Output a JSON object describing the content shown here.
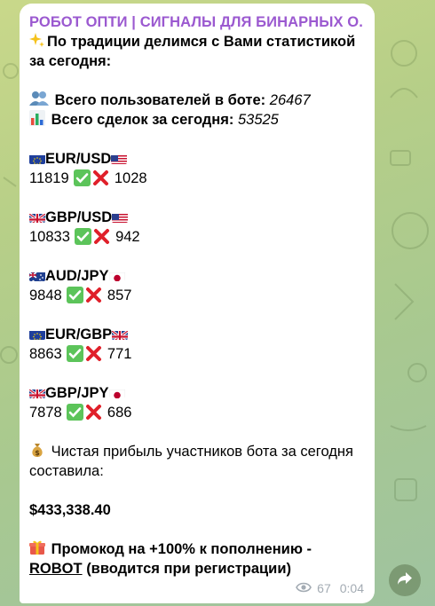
{
  "message": {
    "sender": "РОБОТ ОПТИ | СИГНАЛЫ ДЛЯ БИНАРНЫХ О...",
    "intro_line1": "По традиции делимся с Вами статистикой",
    "intro_line2": "за сегодня:",
    "users_label": "Всего пользователей в боте:",
    "users_value": "26467",
    "deals_label": "Всего сделок за сегодня:",
    "deals_value": "53525",
    "pairs": [
      {
        "name": "EUR/USD",
        "wins": "11819",
        "losses": "1028"
      },
      {
        "name": "GBP/USD",
        "wins": "10833",
        "losses": "942"
      },
      {
        "name": "AUD/JPY",
        "wins": "9848",
        "losses": "857"
      },
      {
        "name": "EUR/GBP",
        "wins": "8863",
        "losses": "771"
      },
      {
        "name": "GBP/JPY",
        "wins": "7878",
        "losses": "686"
      }
    ],
    "profit_line1": "Чистая прибыль участников бота за сегодня",
    "profit_line2": "составила:",
    "profit_value": "$433,338.40",
    "promo_line1": "Промокод на +100% к пополнению -",
    "promo_code": "ROBOT",
    "promo_rest": "(вводится при регистрации)",
    "views": "67",
    "time": "0:04"
  },
  "icons": {
    "sparkles": "sparkles-icon",
    "users": "busts-icon",
    "chart": "bar-chart-icon",
    "win": "check-mark-button-icon",
    "loss": "cross-mark-icon",
    "money": "money-bag-icon",
    "gift": "gift-icon",
    "views": "eye-icon",
    "share": "share-arrow-icon"
  },
  "colors": {
    "sender": "#9b59d0",
    "win": "#5cc45a",
    "loss": "#e0202a",
    "meta": "#a3abb3"
  }
}
